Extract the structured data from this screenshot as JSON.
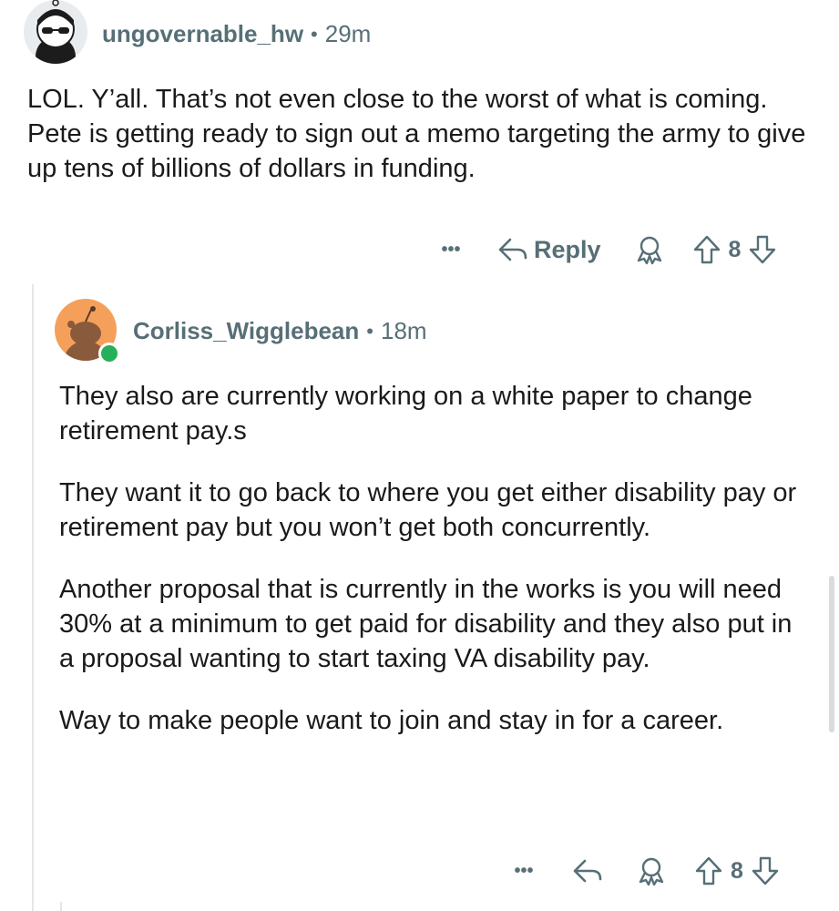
{
  "comments": [
    {
      "username": "ungovernable_hw",
      "separator": "•",
      "time": "29m",
      "avatar_icon": "snoo-sunglasses-avatar",
      "paragraphs": [
        "LOL. Y’all. That’s not even close to the worst of what is coming. Pete is getting ready to sign out a memo targeting the army to give up tens of billions of dollars in funding."
      ],
      "actions": {
        "more": "•••",
        "reply": "Reply",
        "score": "8"
      }
    },
    {
      "username": "Corliss_Wigglebean",
      "separator": "•",
      "time": "18m",
      "avatar_icon": "snoo-orange-avatar",
      "online": true,
      "paragraphs": [
        "They also are currently working on a white paper to change retirement pay.s",
        "They want it to go back to where you get either disability pay or retirement pay but you won’t get both concurrently.",
        "Another proposal that is currently in the works is you will need 30% at a minimum to get paid for disability and they also put in a proposal wanting to start taxing VA disability pay.",
        "Way to make people want to join and stay in for a career."
      ],
      "actions": {
        "more": "•••",
        "score": "8"
      }
    }
  ],
  "colors": {
    "meta": "#576f76",
    "text": "#1a1a1b",
    "online": "#27b05a",
    "thread_line": "#e4e8ea"
  }
}
